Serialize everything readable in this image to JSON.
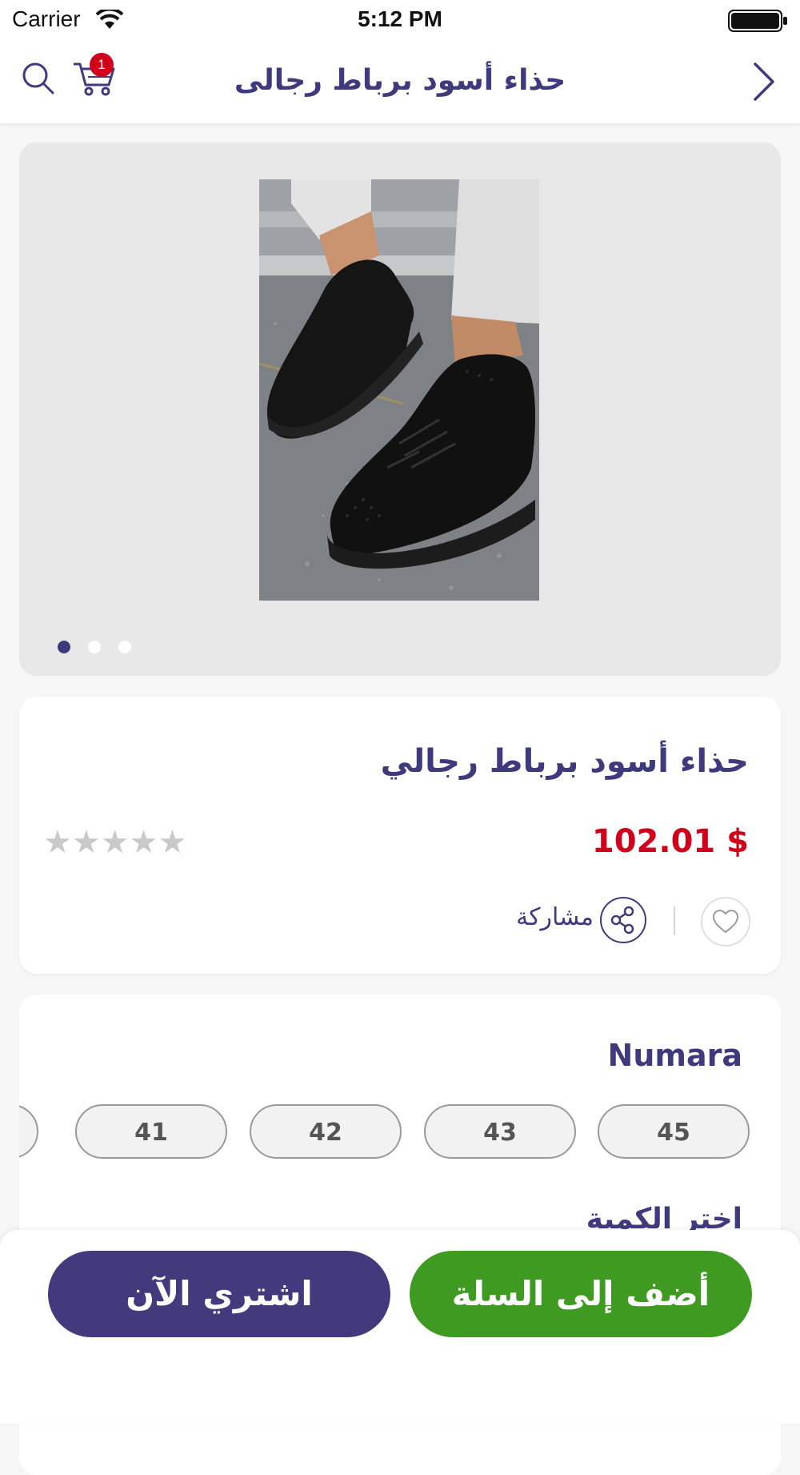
{
  "status_bar": {
    "carrier": "Carrier",
    "time": "5:12 PM"
  },
  "nav": {
    "title": "حذاء أسود برباط رجالى",
    "cart_count": "1",
    "icons": {
      "search": "search-icon",
      "cart": "cart-icon",
      "back": "chevron-right-icon"
    }
  },
  "gallery": {
    "image_alt": "black slip-on sneaker",
    "page_count": 3,
    "active_index": 0
  },
  "product": {
    "name": "حذاء أسود برباط رجالي",
    "price": "102.01 $",
    "rating": 0,
    "max_rating": 5,
    "share_label": "مشاركة"
  },
  "options": {
    "size_title": "Numara",
    "sizes": [
      "45",
      "43",
      "42",
      "41",
      ""
    ],
    "quantity_label": "اختر الكمية"
  },
  "actions": {
    "add_to_cart": "أضف إلى السلة",
    "buy_now": "اشتري الآن"
  },
  "colors": {
    "brand": "#3f3a7d",
    "price": "#d0021b",
    "add_to_cart": "#3f9a22",
    "buy_now": "#433a7e"
  }
}
